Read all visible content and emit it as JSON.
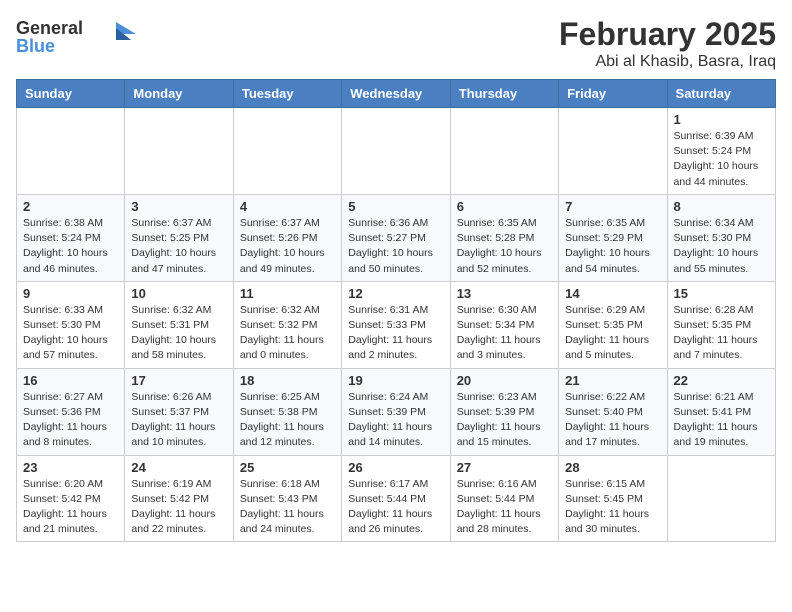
{
  "logo": {
    "general": "General",
    "blue": "Blue"
  },
  "title": "February 2025",
  "subtitle": "Abi al Khasib, Basra, Iraq",
  "weekdays": [
    "Sunday",
    "Monday",
    "Tuesday",
    "Wednesday",
    "Thursday",
    "Friday",
    "Saturday"
  ],
  "weeks": [
    [
      {
        "day": "",
        "info": ""
      },
      {
        "day": "",
        "info": ""
      },
      {
        "day": "",
        "info": ""
      },
      {
        "day": "",
        "info": ""
      },
      {
        "day": "",
        "info": ""
      },
      {
        "day": "",
        "info": ""
      },
      {
        "day": "1",
        "info": "Sunrise: 6:39 AM\nSunset: 5:24 PM\nDaylight: 10 hours and 44 minutes."
      }
    ],
    [
      {
        "day": "2",
        "info": "Sunrise: 6:38 AM\nSunset: 5:24 PM\nDaylight: 10 hours and 46 minutes."
      },
      {
        "day": "3",
        "info": "Sunrise: 6:37 AM\nSunset: 5:25 PM\nDaylight: 10 hours and 47 minutes."
      },
      {
        "day": "4",
        "info": "Sunrise: 6:37 AM\nSunset: 5:26 PM\nDaylight: 10 hours and 49 minutes."
      },
      {
        "day": "5",
        "info": "Sunrise: 6:36 AM\nSunset: 5:27 PM\nDaylight: 10 hours and 50 minutes."
      },
      {
        "day": "6",
        "info": "Sunrise: 6:35 AM\nSunset: 5:28 PM\nDaylight: 10 hours and 52 minutes."
      },
      {
        "day": "7",
        "info": "Sunrise: 6:35 AM\nSunset: 5:29 PM\nDaylight: 10 hours and 54 minutes."
      },
      {
        "day": "8",
        "info": "Sunrise: 6:34 AM\nSunset: 5:30 PM\nDaylight: 10 hours and 55 minutes."
      }
    ],
    [
      {
        "day": "9",
        "info": "Sunrise: 6:33 AM\nSunset: 5:30 PM\nDaylight: 10 hours and 57 minutes."
      },
      {
        "day": "10",
        "info": "Sunrise: 6:32 AM\nSunset: 5:31 PM\nDaylight: 10 hours and 58 minutes."
      },
      {
        "day": "11",
        "info": "Sunrise: 6:32 AM\nSunset: 5:32 PM\nDaylight: 11 hours and 0 minutes."
      },
      {
        "day": "12",
        "info": "Sunrise: 6:31 AM\nSunset: 5:33 PM\nDaylight: 11 hours and 2 minutes."
      },
      {
        "day": "13",
        "info": "Sunrise: 6:30 AM\nSunset: 5:34 PM\nDaylight: 11 hours and 3 minutes."
      },
      {
        "day": "14",
        "info": "Sunrise: 6:29 AM\nSunset: 5:35 PM\nDaylight: 11 hours and 5 minutes."
      },
      {
        "day": "15",
        "info": "Sunrise: 6:28 AM\nSunset: 5:35 PM\nDaylight: 11 hours and 7 minutes."
      }
    ],
    [
      {
        "day": "16",
        "info": "Sunrise: 6:27 AM\nSunset: 5:36 PM\nDaylight: 11 hours and 8 minutes."
      },
      {
        "day": "17",
        "info": "Sunrise: 6:26 AM\nSunset: 5:37 PM\nDaylight: 11 hours and 10 minutes."
      },
      {
        "day": "18",
        "info": "Sunrise: 6:25 AM\nSunset: 5:38 PM\nDaylight: 11 hours and 12 minutes."
      },
      {
        "day": "19",
        "info": "Sunrise: 6:24 AM\nSunset: 5:39 PM\nDaylight: 11 hours and 14 minutes."
      },
      {
        "day": "20",
        "info": "Sunrise: 6:23 AM\nSunset: 5:39 PM\nDaylight: 11 hours and 15 minutes."
      },
      {
        "day": "21",
        "info": "Sunrise: 6:22 AM\nSunset: 5:40 PM\nDaylight: 11 hours and 17 minutes."
      },
      {
        "day": "22",
        "info": "Sunrise: 6:21 AM\nSunset: 5:41 PM\nDaylight: 11 hours and 19 minutes."
      }
    ],
    [
      {
        "day": "23",
        "info": "Sunrise: 6:20 AM\nSunset: 5:42 PM\nDaylight: 11 hours and 21 minutes."
      },
      {
        "day": "24",
        "info": "Sunrise: 6:19 AM\nSunset: 5:42 PM\nDaylight: 11 hours and 22 minutes."
      },
      {
        "day": "25",
        "info": "Sunrise: 6:18 AM\nSunset: 5:43 PM\nDaylight: 11 hours and 24 minutes."
      },
      {
        "day": "26",
        "info": "Sunrise: 6:17 AM\nSunset: 5:44 PM\nDaylight: 11 hours and 26 minutes."
      },
      {
        "day": "27",
        "info": "Sunrise: 6:16 AM\nSunset: 5:44 PM\nDaylight: 11 hours and 28 minutes."
      },
      {
        "day": "28",
        "info": "Sunrise: 6:15 AM\nSunset: 5:45 PM\nDaylight: 11 hours and 30 minutes."
      },
      {
        "day": "",
        "info": ""
      }
    ]
  ]
}
